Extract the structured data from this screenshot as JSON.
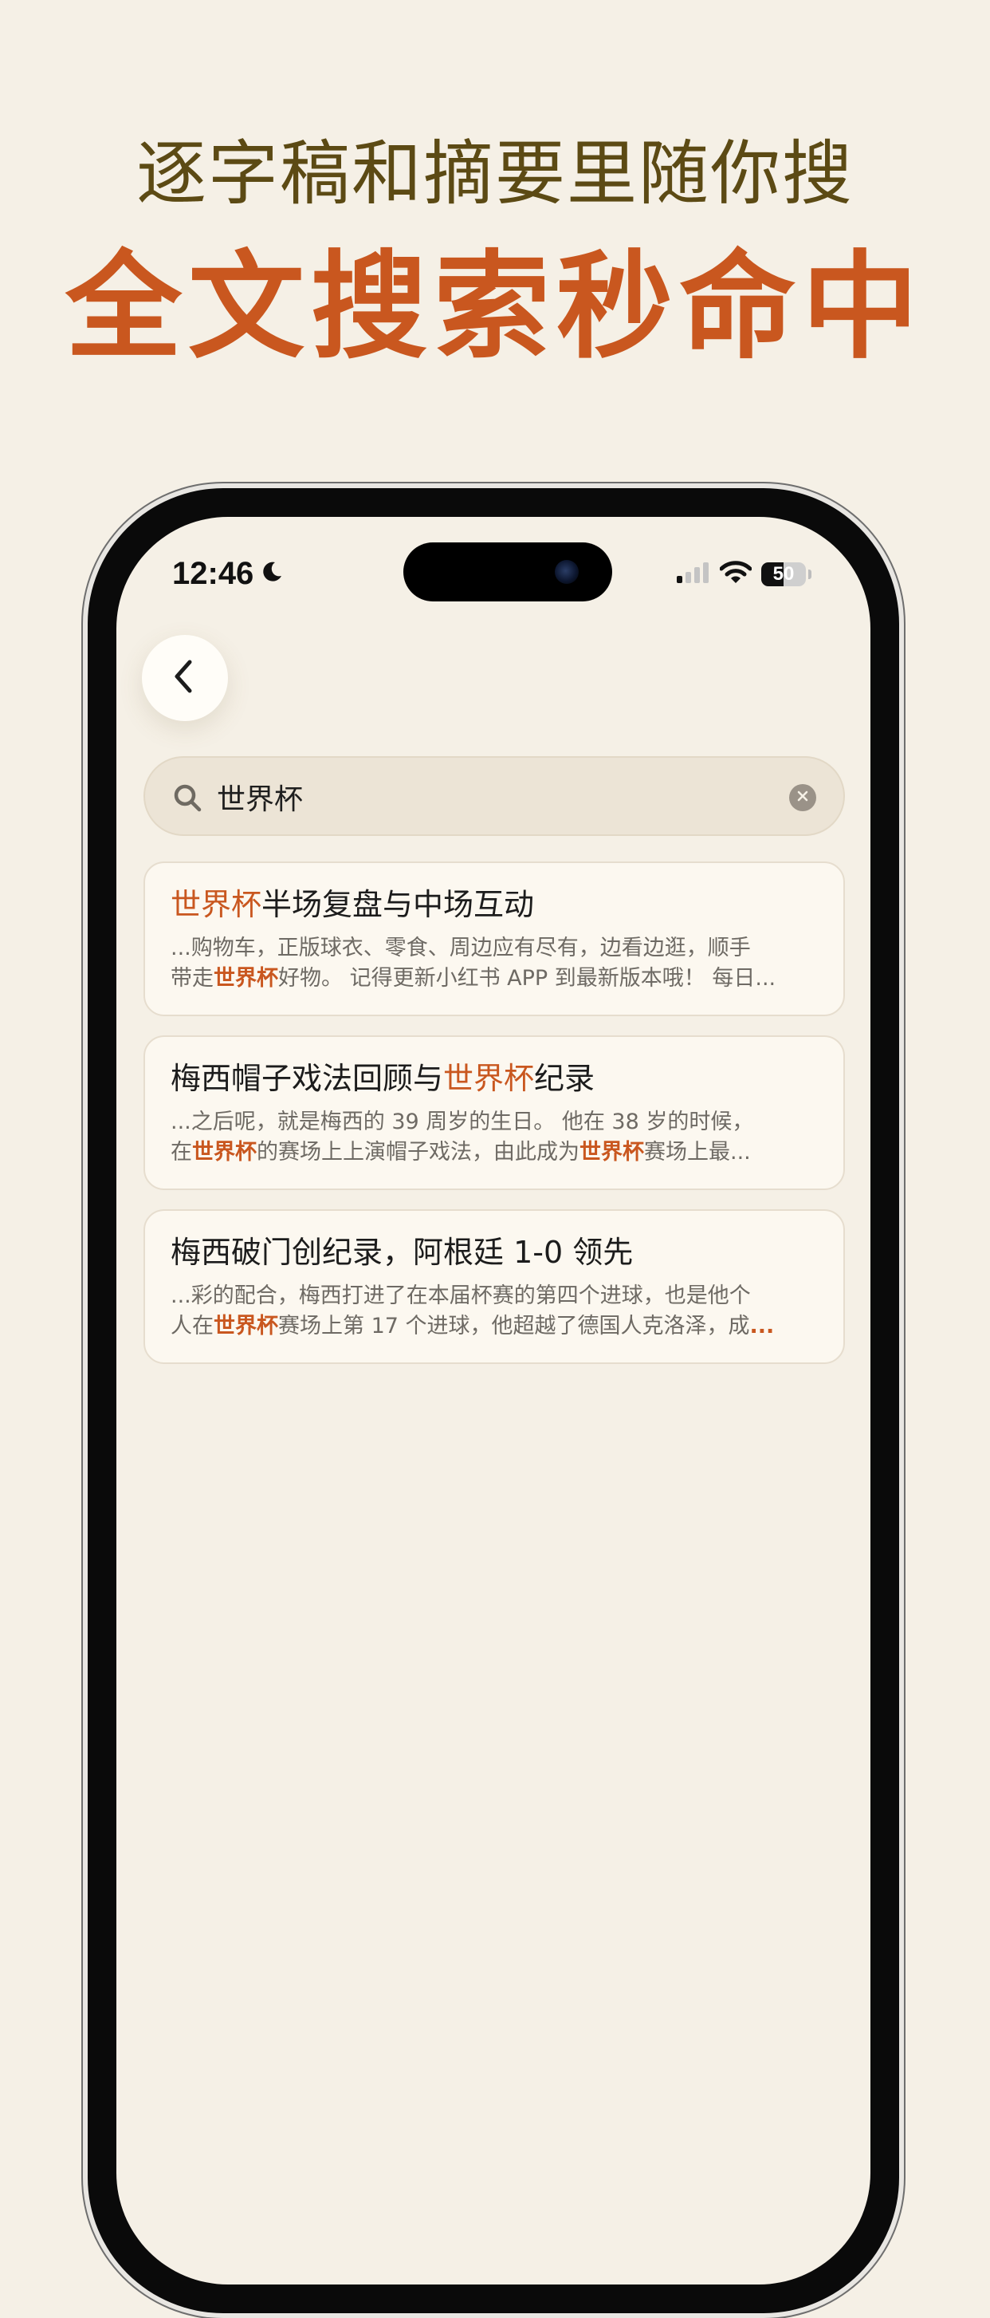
{
  "promo": {
    "subtitle": "逐字稿和摘要里随你搜",
    "headline": "全文搜索秒命中"
  },
  "status_bar": {
    "time": "12:46",
    "battery": "50",
    "battery_level": 0.5
  },
  "search": {
    "query": "世界杯"
  },
  "results": [
    {
      "title_before": "",
      "title_match": "世界杯",
      "title_after": "半场复盘与中场互动",
      "line1_before": "...购物车，正版球衣、零食、周边应有尽有，边看边逛，顺手",
      "line1_match": "",
      "line1_after": "",
      "line2_before": "带走",
      "line2_match": "世界杯",
      "line2_after": "好物。 记得更新小红书 APP 到最新版本哦！ 每日..."
    },
    {
      "title_before": "梅西帽子戏法回顾与",
      "title_match": "世界杯",
      "title_after": "纪录",
      "line1_before": "...之后呢，就是梅西的 39 周岁的生日。 他在 38 岁的时候，",
      "line1_match": "",
      "line1_after": "",
      "line2_before": "在",
      "line2_match": "世界杯",
      "line2_mid": "的赛场上上演帽子戏法，由此成为",
      "line2_match2": "世界杯",
      "line2_after": "赛场上最..."
    },
    {
      "title_before": "梅西破门创纪录，阿根廷 1-0 领先",
      "title_match": "",
      "title_after": "",
      "line1_before": "...彩的配合，梅西打进了在本届杯赛的第四个进球，也是他个",
      "line1_match": "",
      "line1_after": "",
      "line2_before": "人在",
      "line2_match": "世界杯",
      "line2_after": "赛场上第 17 个进球，他超越了德国人克洛泽，成",
      "line2_ellipsis": "..."
    }
  ],
  "colors": {
    "accent": "#C9571F",
    "subtitle": "#5C4A14",
    "background": "#F5F0E6",
    "card": "#FCF8F0",
    "search_bar": "#ECE4D6"
  },
  "icons": [
    "moon-icon",
    "signal-icon",
    "wifi-icon",
    "battery-icon",
    "back-chevron-icon",
    "search-icon",
    "clear-icon"
  ]
}
